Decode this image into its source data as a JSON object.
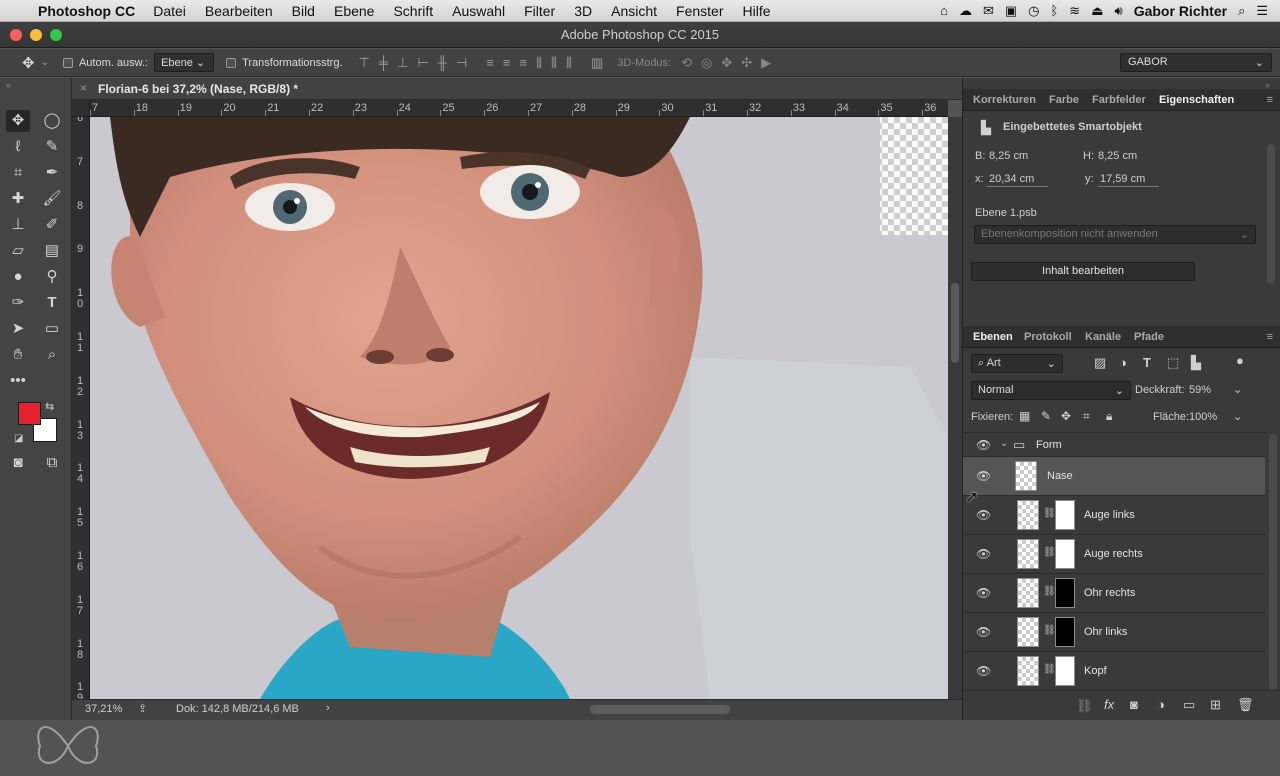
{
  "menubar": {
    "app": "Photoshop CC",
    "items": [
      "Datei",
      "Bearbeiten",
      "Bild",
      "Ebene",
      "Schrift",
      "Auswahl",
      "Filter",
      "3D",
      "Ansicht",
      "Fenster",
      "Hilfe"
    ],
    "user": "Gabor Richter"
  },
  "window": {
    "title": "Adobe Photoshop CC 2015"
  },
  "options": {
    "auto_select_label": "Autom. ausw.:",
    "auto_select_value": "Ebene",
    "transform_label": "Transformationsstrg.",
    "mode_3d_label": "3D-Modus:",
    "workspace": "GABOR"
  },
  "document": {
    "tab_title": "Florian-6 bei 37,2% (Nase, RGB/8) *",
    "ruler_top": [
      "7",
      "18",
      "19",
      "20",
      "21",
      "22",
      "23",
      "24",
      "25",
      "26",
      "27",
      "28",
      "29",
      "30",
      "31",
      "32",
      "33",
      "34",
      "35",
      "36"
    ],
    "ruler_left": [
      "6",
      "7",
      "8",
      "9",
      "1\n0",
      "1\n1",
      "1\n2",
      "1\n3",
      "1\n4",
      "1\n5",
      "1\n6",
      "1\n7",
      "1\n8",
      "1\n9",
      "2\n0"
    ]
  },
  "status": {
    "zoom": "37,21%",
    "doc": "Dok: 142,8 MB/214,6 MB"
  },
  "properties_panel": {
    "tabs": [
      "Korrekturen",
      "Farbe",
      "Farbfelder",
      "Eigenschaften"
    ],
    "active_tab": 3,
    "type": "Eingebettetes Smartobjekt",
    "w_label": "B:",
    "w_value": "8,25 cm",
    "h_label": "H:",
    "h_value": "8,25 cm",
    "x_label": "x:",
    "x_value": "20,34 cm",
    "y_label": "y:",
    "y_value": "17,59 cm",
    "source_file": "Ebene 1.psb",
    "comp_placeholder": "Ebenenkomposition nicht anwenden",
    "edit_button": "Inhalt bearbeiten"
  },
  "layers_panel": {
    "tabs": [
      "Ebenen",
      "Protokoll",
      "Kanäle",
      "Pfade"
    ],
    "active_tab": 0,
    "filter_kind": "Art",
    "blend_mode": "Normal",
    "opacity_label": "Deckkraft:",
    "opacity": "59%",
    "lock_label": "Fixieren:",
    "fill_label": "Fläche:",
    "fill": "100%",
    "group": "Form",
    "layers": [
      {
        "name": "Nase",
        "selected": true,
        "mask": "none"
      },
      {
        "name": "Auge links",
        "selected": false,
        "mask": "white"
      },
      {
        "name": "Auge rechts",
        "selected": false,
        "mask": "white"
      },
      {
        "name": "Ohr rechts",
        "selected": false,
        "mask": "black"
      },
      {
        "name": "Ohr links",
        "selected": false,
        "mask": "black"
      },
      {
        "name": "Kopf",
        "selected": false,
        "mask": "white"
      }
    ]
  },
  "colors": {
    "foreground": "#e8202e",
    "background": "#ffffff",
    "accent_selected": "#555555"
  }
}
